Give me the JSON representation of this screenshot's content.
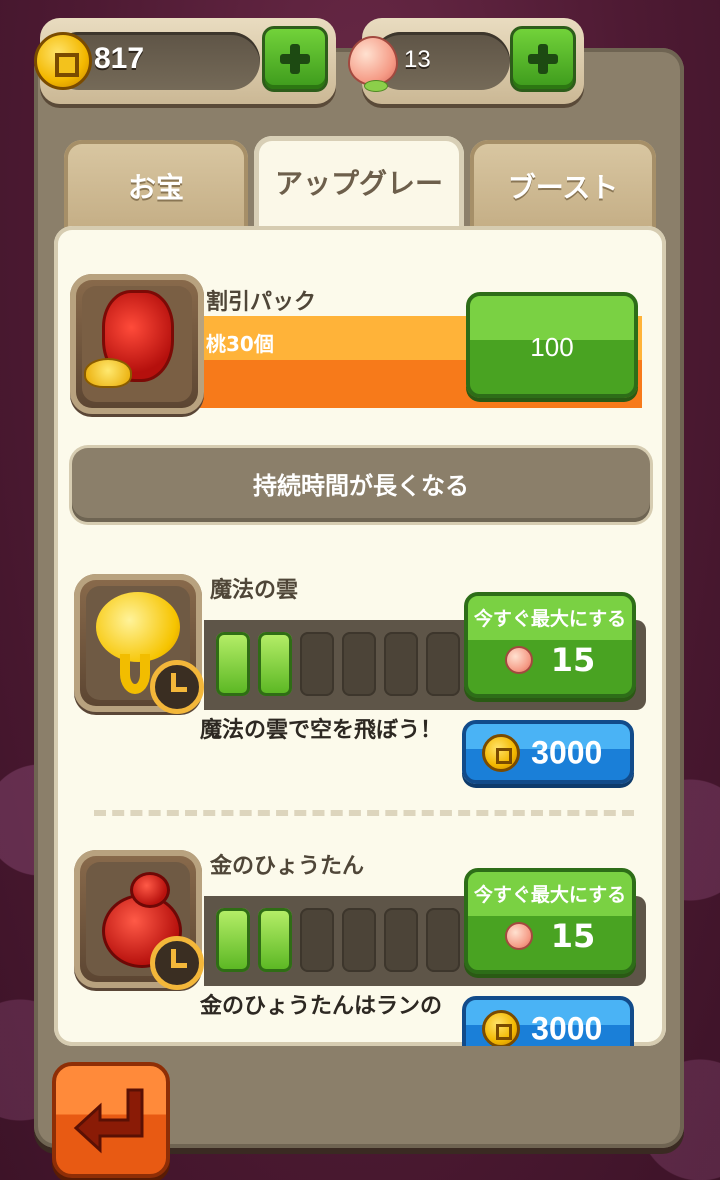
{
  "header": {
    "coins": "817",
    "peaches": "13"
  },
  "tabs": [
    {
      "label": "お宝"
    },
    {
      "label": "アップグレー"
    },
    {
      "label": "ブースト"
    }
  ],
  "pack": {
    "title": "割引パック",
    "subtitle": "桃30個",
    "price": "100"
  },
  "section": {
    "label": "持続時間が長くなる"
  },
  "upgrades": [
    {
      "name": "魔法の雲",
      "description": "魔法の雲で空を飛ぼう！",
      "level": 2,
      "max_level": 6,
      "max_now_label": "今すぐ最大にする",
      "max_now_cost": "15",
      "coin_cost": "3000"
    },
    {
      "name": "金のひょうたん",
      "description": "金のひょうたんはランの",
      "level": 2,
      "max_level": 6,
      "max_now_label": "今すぐ最大にする",
      "max_now_cost": "15",
      "coin_cost": "3000"
    }
  ]
}
